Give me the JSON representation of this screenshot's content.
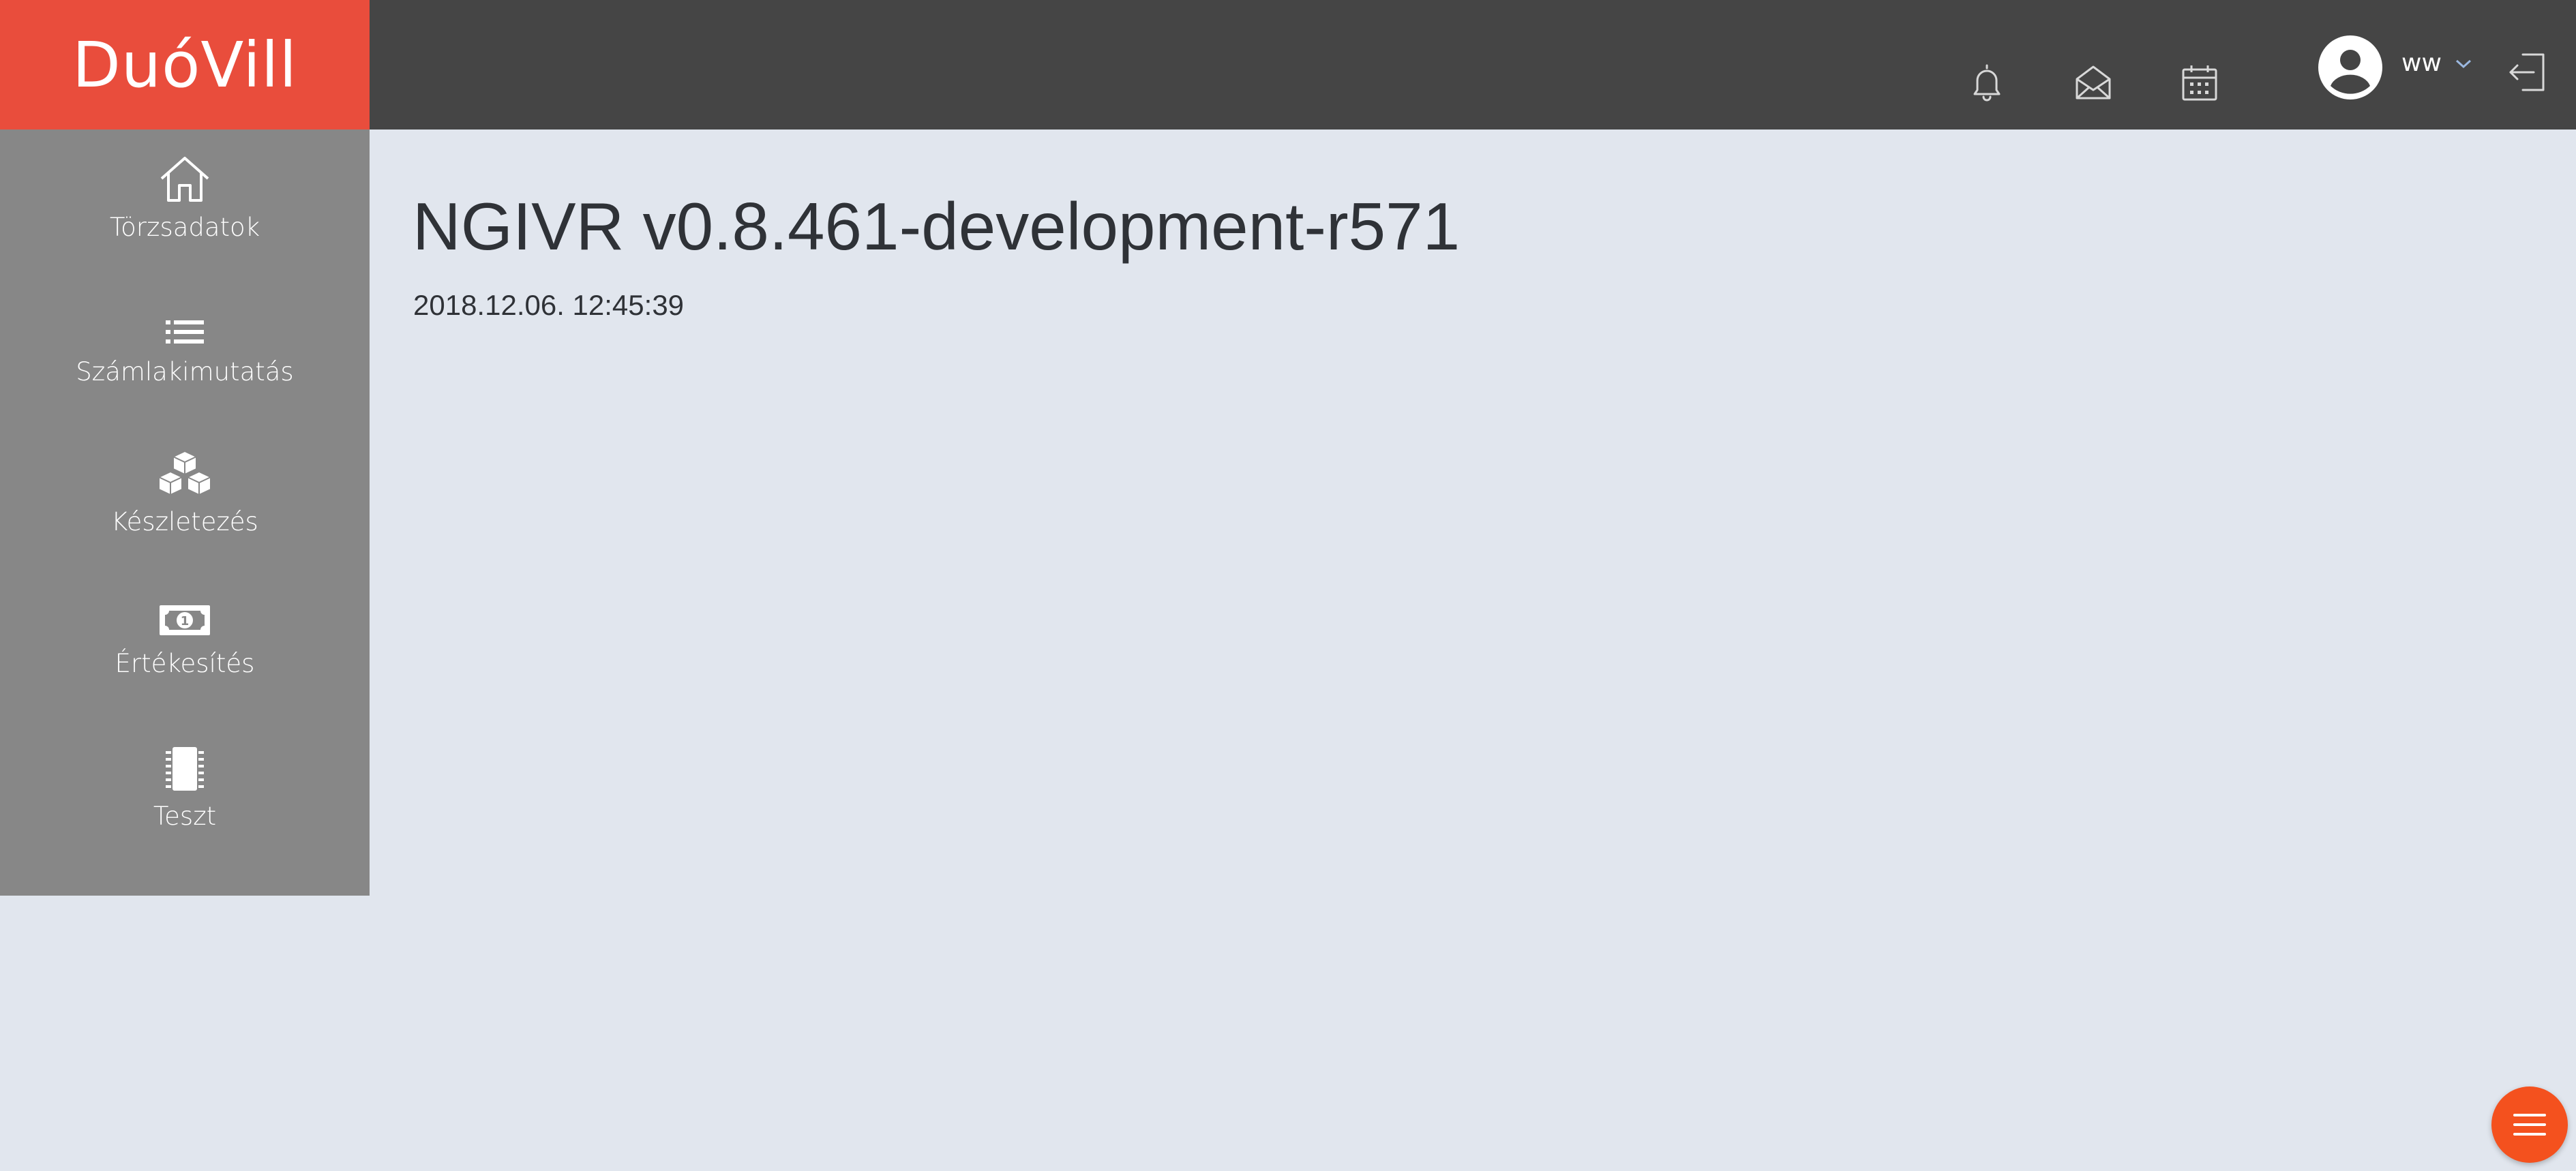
{
  "app": {
    "brand": "DuóVill"
  },
  "header": {
    "icons": [
      "bell-icon",
      "envelope-open-icon",
      "calendar-icon"
    ],
    "user": {
      "name": "ww"
    }
  },
  "sidebar": {
    "items": [
      {
        "label": "Törzsadatok",
        "icon": "home-icon"
      },
      {
        "label": "Számlakimutatás",
        "icon": "list-icon"
      },
      {
        "label": "Készletezés",
        "icon": "cubes-icon"
      },
      {
        "label": "Értékesítés",
        "icon": "money-bill-icon"
      },
      {
        "label": "Teszt",
        "icon": "microchip-icon"
      }
    ]
  },
  "main": {
    "title": "NGIVR v0.8.461-development-r571",
    "timestamp": "2018.12.06. 12:45:39"
  },
  "colors": {
    "brand": "#e94d3c",
    "topbar": "#454545",
    "sidebar": "#878787",
    "background": "#e1e6ee",
    "fab": "#f4511e"
  }
}
